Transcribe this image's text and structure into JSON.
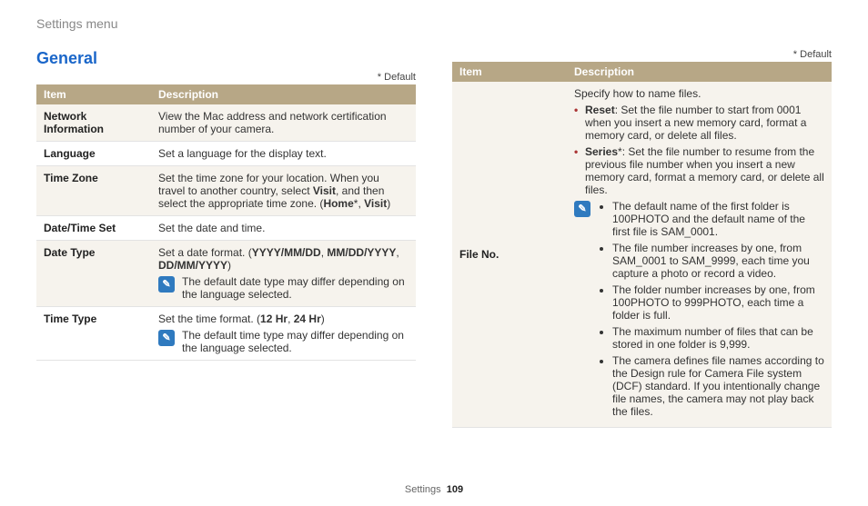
{
  "breadcrumb": "Settings menu",
  "section_title": "General",
  "default_note": "* Default",
  "headers": {
    "item": "Item",
    "description": "Description"
  },
  "left": {
    "network": {
      "item": "Network Information",
      "desc": "View the Mac address and network certification number of your camera."
    },
    "language": {
      "item": "Language",
      "desc": "Set a language for the display text."
    },
    "timezone": {
      "item": "Time Zone",
      "desc_a": "Set the time zone for your location. When you travel to another country, select ",
      "visit1": "Visit",
      "desc_b": ", and then select the appropriate time zone. (",
      "home": "Home",
      "star1": "*, ",
      "visit2": "Visit",
      "desc_c": ")"
    },
    "datetime": {
      "item": "Date/Time Set",
      "desc": "Set the date and time."
    },
    "datetype": {
      "item": "Date Type",
      "desc_a": "Set a date format. (",
      "f1": "YYYY/MM/DD",
      "c1": ", ",
      "f2": "MM/DD/YYYY",
      "c2": ", ",
      "f3": "DD/MM/YYYY",
      "desc_b": ")",
      "note": "The default date type may differ depending on the language selected."
    },
    "timetype": {
      "item": "Time Type",
      "desc_a": "Set the time format. (",
      "f1": "12 Hr",
      "c1": ", ",
      "f2": "24 Hr",
      "desc_b": ")",
      "note": "The default time type may differ depending on the language selected."
    }
  },
  "right": {
    "fileno": {
      "item": "File No.",
      "intro": "Specify how to name files.",
      "reset_label": "Reset",
      "reset_desc": ": Set the file number to start from 0001 when you insert a new memory card, format a memory card, or delete all files.",
      "series_label": "Series",
      "series_star": "*",
      "series_desc": ": Set the file number to resume from the previous file number when you insert a new memory card, format a memory card, or delete all files.",
      "notes": {
        "n1": "The default name of the first folder is 100PHOTO and the default name of the first file is SAM_0001.",
        "n2": "The file number increases by one, from SAM_0001 to SAM_9999, each time you capture a photo or record a video.",
        "n3": "The folder number increases by one, from 100PHOTO to 999PHOTO, each time a folder is full.",
        "n4": "The maximum number of files that can be stored in one folder is 9,999.",
        "n5": "The camera defines file names according to the Design rule for Camera File system (DCF) standard. If you intentionally change file names, the camera may not play back the files."
      }
    }
  },
  "note_icon_glyph": "✎",
  "footer": {
    "label": "Settings",
    "page": "109"
  }
}
